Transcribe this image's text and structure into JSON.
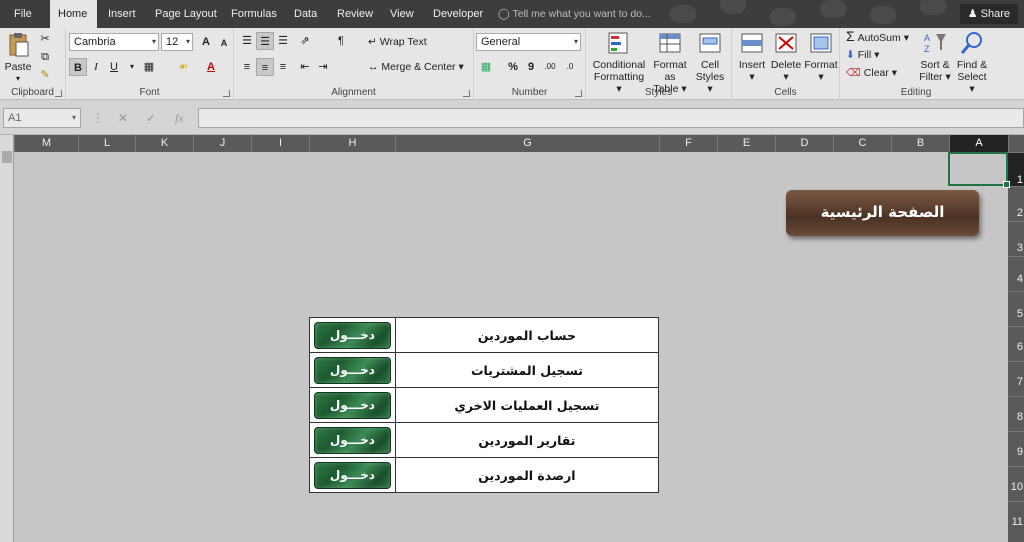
{
  "menu": {
    "tabs": [
      "File",
      "Home",
      "Insert",
      "Page Layout",
      "Formulas",
      "Data",
      "Review",
      "View",
      "Developer"
    ],
    "active": "Home",
    "tell_me": "Tell me what you want to do...",
    "share": "Share"
  },
  "ribbon": {
    "clipboard": {
      "paste": "Paste",
      "label": "Clipboard"
    },
    "font": {
      "family": "Cambria",
      "size": "12",
      "bold": "B",
      "italic": "I",
      "underline": "U",
      "grow": "A",
      "shrink": "A",
      "color_letter": "A",
      "label": "Font"
    },
    "alignment": {
      "wrap": "Wrap Text",
      "merge": "Merge & Center",
      "label": "Alignment"
    },
    "number": {
      "format": "General",
      "percent": "%",
      "comma": "9",
      "label": "Number",
      "inc_decimals": ".00",
      "dec_decimals": ".0"
    },
    "styles": {
      "conditional_1": "Conditional",
      "conditional_2": "Formatting",
      "format_table_1": "Format as",
      "format_table_2": "Table",
      "cell_styles_1": "Cell",
      "cell_styles_2": "Styles",
      "label": "Styles"
    },
    "cells": {
      "insert": "Insert",
      "delete": "Delete",
      "format": "Format",
      "label": "Cells"
    },
    "editing": {
      "autosum": "AutoSum",
      "fill": "Fill",
      "clear": "Clear",
      "sort_1": "Sort &",
      "sort_2": "Filter",
      "find_1": "Find &",
      "find_2": "Select",
      "label": "Editing"
    }
  },
  "formula_bar": {
    "name_box": "A1",
    "value": ""
  },
  "columns": [
    "M",
    "L",
    "K",
    "J",
    "I",
    "H",
    "G",
    "F",
    "E",
    "D",
    "C",
    "B",
    "A"
  ],
  "selected_column": "A",
  "rows": [
    "1",
    "2",
    "3",
    "4",
    "5",
    "6",
    "7",
    "8",
    "9",
    "10",
    "11"
  ],
  "selected_row": "1",
  "home_button": "الصفحة الرئيسية",
  "menu_table": [
    {
      "label": "حساب الموردين",
      "button": "دخـــول"
    },
    {
      "label": "تسجيل المشتريات",
      "button": "دخـــول"
    },
    {
      "label": "تسجيل العمليات الاخري",
      "button": "دخـــول"
    },
    {
      "label": "تقارير الموردين",
      "button": "دخـــول"
    },
    {
      "label": "ارصدة الموردين",
      "button": "دخـــول"
    }
  ],
  "colors": {
    "accent": "#217346",
    "menu_bg": "#3d3d3d",
    "ribbon_bg": "#e6e6e6",
    "sheet_bg": "#c6c6c6"
  }
}
